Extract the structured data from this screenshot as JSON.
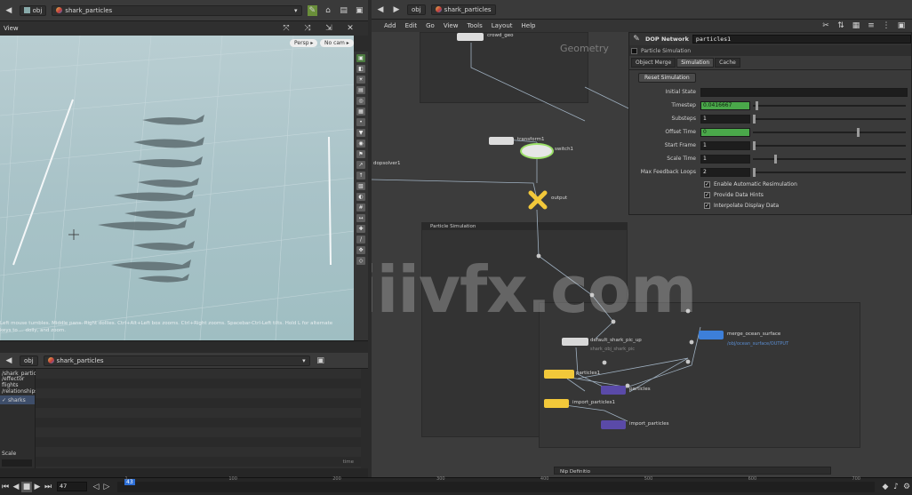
{
  "left_pane": {
    "path": {
      "root": "obj",
      "node": "shark_particles"
    }
  },
  "viewport": {
    "tab_label": "View",
    "camera_label": "Persp ▸",
    "cam_label": "No cam ▸",
    "hint_line1": "Left mouse tumbles. Middle pans. Right dollies. Ctrl+Alt+Left box zooms. Ctrl+Right zooms. Spacebar-Ctrl-Left tilts. Hold L for alternate",
    "hint_line2": "keys to ... dolly, and zoom."
  },
  "bottom_left": {
    "path": {
      "root": "obj",
      "node": "shark_particles"
    },
    "tree": [
      "/shark_partic",
      "/effector flights",
      "/relationships",
      "sharks"
    ],
    "scale_label": "Scale",
    "time_label": "time"
  },
  "network": {
    "path": {
      "root": "obj",
      "node": "shark_particles"
    },
    "menu": [
      "Add",
      "Edit",
      "Go",
      "View",
      "Tools",
      "Layout",
      "Help"
    ],
    "geometry_label": "Geometry",
    "particle_box_label": "Particle Simulation",
    "bottom_box_label": "Nip Definitio",
    "nodes": {
      "crowd_geo": "crowd_geo",
      "transform1": "transform1",
      "switch1": "switch1",
      "switch1_sub": "1 switch",
      "sim_left": "dopsolver1",
      "output": "output",
      "default_shark": "default_shark_pic_up",
      "default_shark_sub": "shark_obj_shark_pic",
      "particles1": "particles1",
      "particles": "particles",
      "import_particles1": "import_particles1",
      "import_particles": "import_particles",
      "merge_ocean": "merge_ocean_surface",
      "merge_ocean_sub": "/obj/ocean_surface/OUTPUT"
    }
  },
  "params": {
    "node_type": "DOP Network",
    "node_name": "particles1",
    "sim_title": "Particle Simulation",
    "tabs": [
      "Object Merge",
      "Simulation",
      "Cache"
    ],
    "active_tab": "Simulation",
    "reset_button": "Reset Simulation",
    "initial_state_label": "Initial State",
    "rows": [
      {
        "label": "Timestep",
        "value": "0.0416667",
        "green": true,
        "fill": 0.02
      },
      {
        "label": "Substeps",
        "value": "1",
        "green": false,
        "fill": 0.0
      },
      {
        "label": "Offset Time",
        "value": "0",
        "green": true,
        "fill": 0.68
      },
      {
        "label": "Start Frame",
        "value": "1",
        "green": false,
        "fill": 0.0
      },
      {
        "label": "Scale Time",
        "value": "1",
        "green": false,
        "fill": 0.14
      },
      {
        "label": "Max Feedback Loops",
        "value": "2",
        "green": false,
        "fill": 0.0
      }
    ],
    "checks": [
      "Enable Automatic Resimulation",
      "Provide Data Hints",
      "Interpolate Display Data"
    ]
  },
  "timeline": {
    "frame": "47",
    "marker": "43",
    "ticks": [
      "1",
      "100",
      "200",
      "300",
      "400",
      "500",
      "600",
      "700"
    ]
  },
  "watermark": "iiivfx.com",
  "colors": {
    "accent_yellow": "#f2c83a",
    "accent_green": "#4aa84a",
    "accent_blue": "#3d7fd9",
    "accent_purple": "#5a4aa8"
  }
}
